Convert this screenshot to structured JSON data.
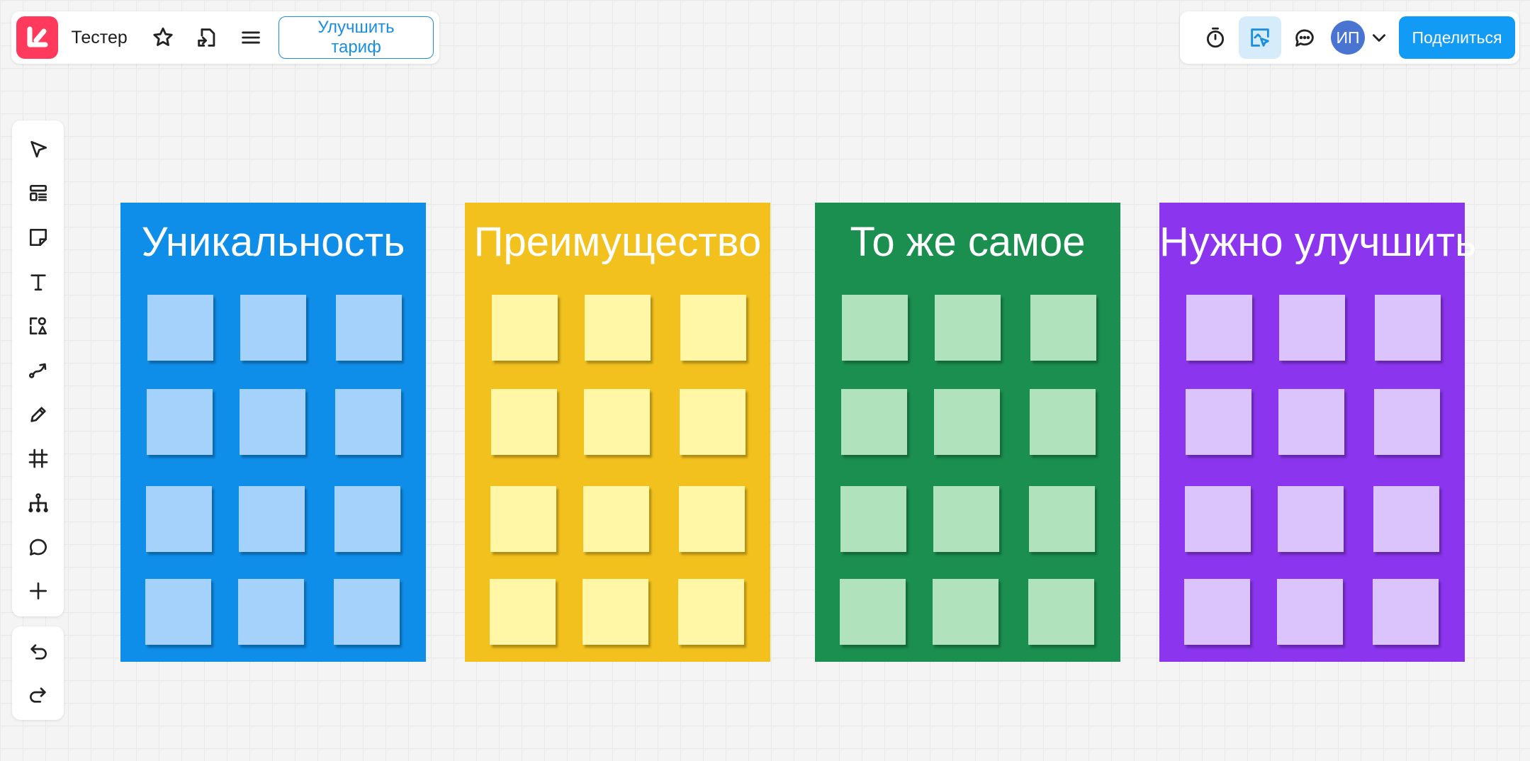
{
  "header": {
    "board_title": "Тестер",
    "upgrade_label": "Улучшить тариф",
    "share_label": "Поделиться",
    "avatar_initials": "ИП",
    "icons": [
      "star-icon",
      "export-icon",
      "menu-icon",
      "timer-icon",
      "presentation-icon",
      "comments-icon",
      "chevron-down-icon"
    ]
  },
  "toolbar": {
    "tools": [
      "select-tool",
      "templates-tool",
      "sticky-note-tool",
      "text-tool",
      "shapes-tool",
      "connector-tool",
      "pen-tool",
      "frame-tool",
      "mindmap-tool",
      "comment-tool",
      "more-tools"
    ],
    "history": [
      "undo",
      "redo"
    ]
  },
  "colors": {
    "logo": "#ff3a5c",
    "accent": "#119bf4"
  },
  "frames": [
    {
      "title": "Уникальность",
      "bg": "#0f8ee9",
      "sticky": "#a4d2fb"
    },
    {
      "title": "Преимущество",
      "bg": "#f2c11d",
      "sticky": "#fff6a6"
    },
    {
      "title": "То же самое",
      "bg": "#1b8f4f",
      "sticky": "#b0e2bb"
    },
    {
      "title": "Нужно улучшить",
      "bg": "#8b35ee",
      "sticky": "#dbc4fb"
    }
  ],
  "stickies_per_frame": {
    "rows": 4,
    "cols": 3
  }
}
